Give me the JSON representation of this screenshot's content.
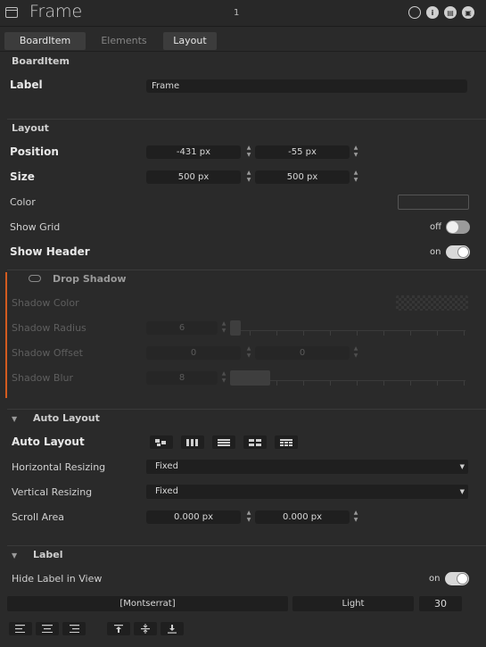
{
  "window": {
    "title": "Frame",
    "index": "1"
  },
  "tabs": [
    {
      "label": "BoardItem",
      "active": true
    },
    {
      "label": "Elements",
      "active": false
    },
    {
      "label": "Layout",
      "active": true
    }
  ],
  "boarditem": {
    "section_title": "BoardItem",
    "label_caption": "Label",
    "label_value": "Frame"
  },
  "layout": {
    "section_title": "Layout",
    "position": {
      "caption": "Position",
      "x": "-431 px",
      "y": "-55 px"
    },
    "size": {
      "caption": "Size",
      "w": "500 px",
      "h": "500 px"
    },
    "color": {
      "caption": "Color"
    },
    "show_grid": {
      "caption": "Show Grid",
      "state": "off"
    },
    "show_header": {
      "caption": "Show Header",
      "state": "on"
    }
  },
  "drop_shadow": {
    "title": "Drop Shadow",
    "shadow_color": {
      "caption": "Shadow Color"
    },
    "shadow_radius": {
      "caption": "Shadow Radius",
      "value": "6",
      "level": 0.02
    },
    "shadow_offset": {
      "caption": "Shadow Offset",
      "x": "0",
      "y": "0"
    },
    "shadow_blur": {
      "caption": "Shadow Blur",
      "value": "8",
      "level": 0.17
    }
  },
  "auto_layout": {
    "title": "Auto Layout",
    "mode_caption": "Auto Layout",
    "mode_icons": [
      "freeform-icon",
      "columns-icon",
      "rows-icon",
      "grid-icon",
      "table-grid-icon"
    ],
    "horizontal_resizing": {
      "caption": "Horizontal Resizing",
      "value": "Fixed"
    },
    "vertical_resizing": {
      "caption": "Vertical Resizing",
      "value": "Fixed"
    },
    "scroll_area": {
      "caption": "Scroll Area",
      "x": "0.000 px",
      "y": "0.000 px"
    }
  },
  "label_section": {
    "title": "Label",
    "hide_label": {
      "caption": "Hide Label in View",
      "state": "on"
    },
    "font_family": "[Montserrat]",
    "font_weight": "Light",
    "font_size": "30"
  },
  "colors": {
    "accent": "#d35b1f",
    "panel": "#2a2a2a",
    "field": "#1f1f1f"
  }
}
